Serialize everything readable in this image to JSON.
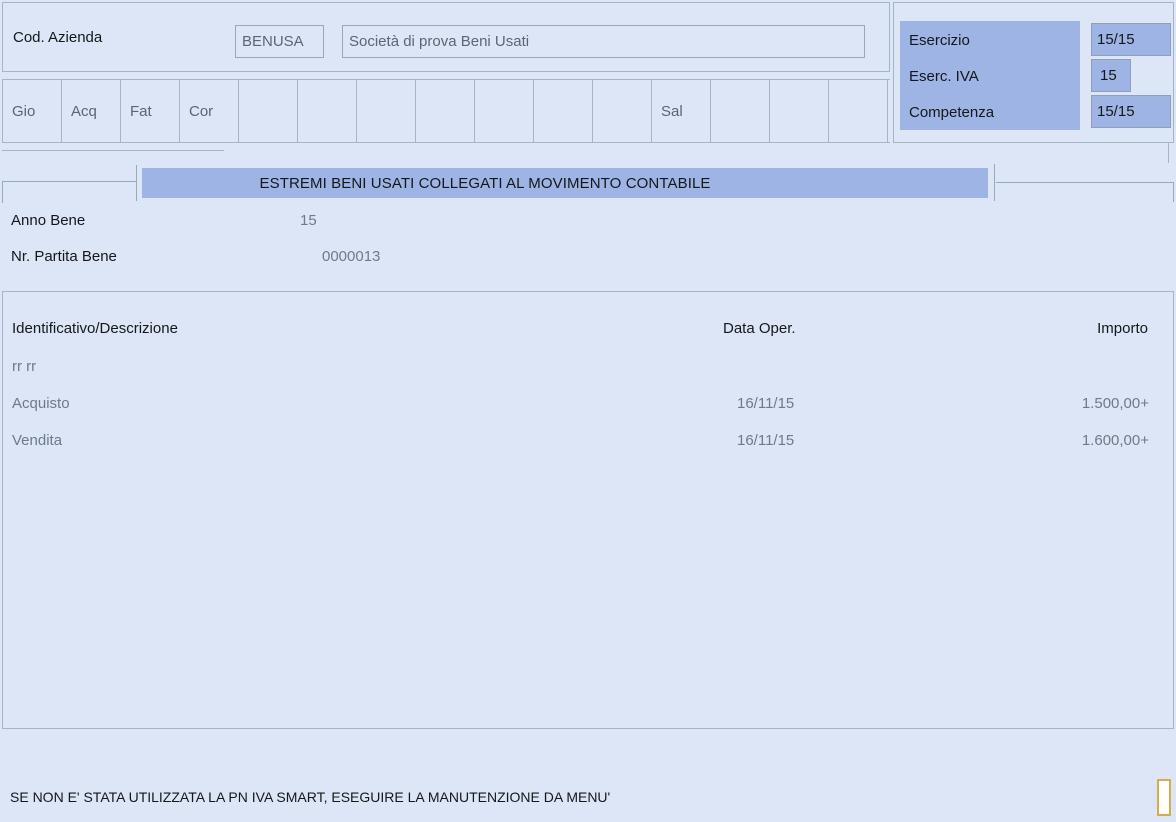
{
  "header": {
    "company_label": "Cod. Azienda",
    "company_code": "BENUSA",
    "company_name": "Società di prova Beni Usati"
  },
  "toolbar": {
    "cells": [
      {
        "label": "Gio"
      },
      {
        "label": "Acq"
      },
      {
        "label": "Fat"
      },
      {
        "label": "Cor"
      },
      {
        "label": ""
      },
      {
        "label": ""
      },
      {
        "label": ""
      },
      {
        "label": ""
      },
      {
        "label": ""
      },
      {
        "label": ""
      },
      {
        "label": ""
      },
      {
        "label": "Sal"
      },
      {
        "label": ""
      },
      {
        "label": ""
      },
      {
        "label": ""
      }
    ]
  },
  "exercise_panel": {
    "labels": [
      "Esercizio",
      "Eserc. IVA",
      "Competenza"
    ],
    "values": [
      "15/15",
      "15",
      "15/15"
    ],
    "accent_color": "#9db4e5"
  },
  "section": {
    "title": "ESTREMI BENI USATI COLLEGATI AL MOVIMENTO CONTABILE"
  },
  "key_fields": [
    {
      "label": "Anno Bene",
      "value": "15"
    },
    {
      "label": "Nr. Partita Bene",
      "value": "0000013"
    }
  ],
  "list": {
    "columns": {
      "description": "Identificativo/Descrizione",
      "date": "Data Oper.",
      "amount": "Importo"
    },
    "rows": [
      {
        "description": "rr rr",
        "date": "",
        "amount": ""
      },
      {
        "description": "Acquisto",
        "date": "16/11/15",
        "amount": "1.500,00+"
      },
      {
        "description": "Vendita",
        "date": "16/11/15",
        "amount": "1.600,00+"
      }
    ]
  },
  "status": {
    "message": "SE NON E' STATA UTILIZZATA LA PN IVA SMART, ESEGUIRE LA MANUTENZIONE DA MENU'",
    "indicator_color": "#d8ab4a"
  }
}
